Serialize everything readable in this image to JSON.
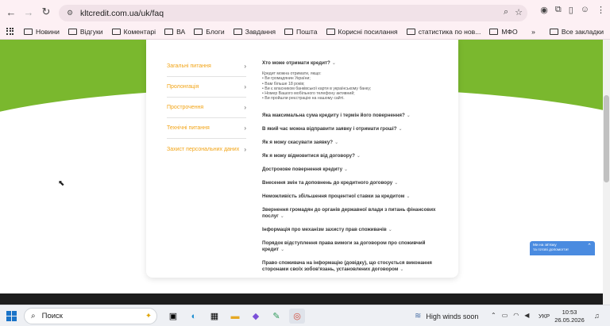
{
  "browser": {
    "url": "kltcredit.com.ua/uk/faq",
    "bookmarks": [
      "Новини",
      "Відгуки",
      "Коментарі",
      "ВА",
      "Блоги",
      "Завдання",
      "Пошта",
      "Корисні посилання",
      "статистика по нов...",
      "МФО"
    ],
    "more": "»",
    "all_bookmarks": "Все закладки"
  },
  "sidebar": {
    "items": [
      {
        "label": "Загальні питання"
      },
      {
        "label": "Пролонгація"
      },
      {
        "label": "Прострочення"
      },
      {
        "label": "Технічні питання"
      },
      {
        "label": "Захист персональних даних"
      }
    ]
  },
  "faq": {
    "open_question": "Хто може отримати кредит?",
    "answer_lines": [
      "Кредит можна отримати, якщо:",
      "• Ви громадянин України;",
      "• Вам більше 18 років;",
      "• Ви є власником банківської карти в українському банку;",
      "• Номер Вашого мобільного телефону активний;",
      "• Ви пройшли реєстрацію на нашому сайті."
    ],
    "questions": [
      "Яка максимальна сума кредиту і термін його повернення?",
      "В який час можна відправити заявку і отримати гроші?",
      "Як я можу скасувати заявку?",
      "Як я можу відмовитися від договору?",
      "Дострокове повернення кредиту",
      "Внесення змін та доповнень до кредитного договору",
      "Неможливість збільшення процентної ставки за кредитом",
      "Звернення громадян до органів державної влади з питань фінансових послуг",
      "Інформація про механізм захисту прав споживачів",
      "Порядок відступлення права вимоги за договором про споживчий кредит",
      "Право споживача на інформацію (довідку), що стосується виконання сторонами своїх зобов'язань, установлених договором"
    ]
  },
  "chat_widget": {
    "line1": "Ми на зв'язку",
    "line2": "та готові допомогти!"
  },
  "taskbar": {
    "search_placeholder": "Поиск",
    "weather": "High winds soon",
    "language": "УКР",
    "time": "10:53",
    "date": "26.05.2026"
  },
  "colors": {
    "accent_green": "#7ab82e",
    "sidebar_orange": "#f2a416"
  }
}
